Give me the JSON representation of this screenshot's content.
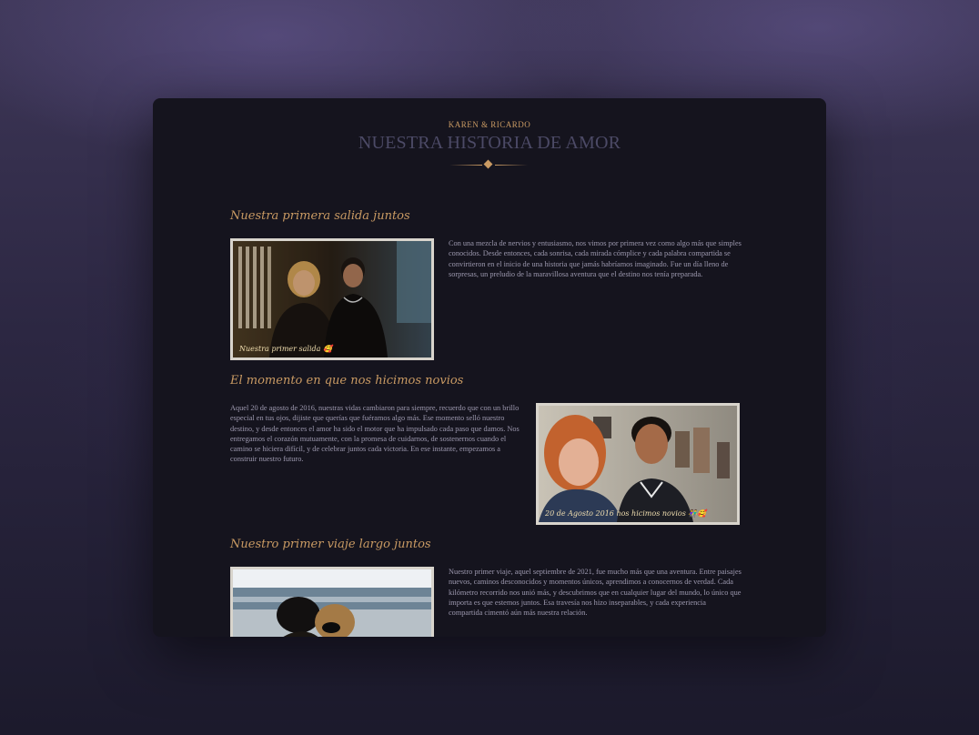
{
  "header": {
    "kicker": "KAREN & RICARDO",
    "title": "NUESTRA HISTORIA DE AMOR"
  },
  "sections": [
    {
      "title": "Nuestra primera salida juntos",
      "caption": "Nuestra primer salida 🥰",
      "text": "Con una mezcla de nervios y entusiasmo, nos vimos por primera vez como algo más que simples conocidos. Desde entonces, cada sonrisa, cada mirada cómplice y cada palabra compartida se convirtieron en el inicio de una historia que jamás habríamos imaginado. Fue un día lleno de sorpresas, un preludio de la maravillosa aventura que el destino nos tenía preparada."
    },
    {
      "title": "El momento en que nos hicimos novios",
      "caption": "20 de Agosto 2016 nos hicimos novios 👫🥰",
      "text": "Aquel 20 de agosto de 2016, nuestras vidas cambiaron para siempre, recuerdo que con un brillo especial en tus ojos, dijiste que querías que fuéramos algo más. Ese momento selló nuestro destino, y desde entonces el amor ha sido el motor que ha impulsado cada paso que damos. Nos entregamos el corazón mutuamente, con la promesa de cuidarnos, de sostenernos cuando el camino se hiciera difícil, y de celebrar juntos cada victoria. En ese instante, empezamos a construir nuestro futuro."
    },
    {
      "title": "Nuestro primer viaje largo juntos",
      "caption": "",
      "text": "Nuestro primer viaje, aquel septiembre de 2021, fue mucho más que una aventura. Entre paisajes nuevos, caminos desconocidos y momentos únicos, aprendimos a conocernos de verdad. Cada kilómetro recorrido nos unió más, y descubrimos que en cualquier lugar del mundo, lo único que importa es que estemos juntos. Esa travesía nos hizo inseparables, y cada experiencia compartida cimentó aún más nuestra relación."
    }
  ],
  "colors": {
    "accent": "#c99a63",
    "card": "#15141e",
    "text": "#9c98ae",
    "title": "#4c4a66"
  }
}
